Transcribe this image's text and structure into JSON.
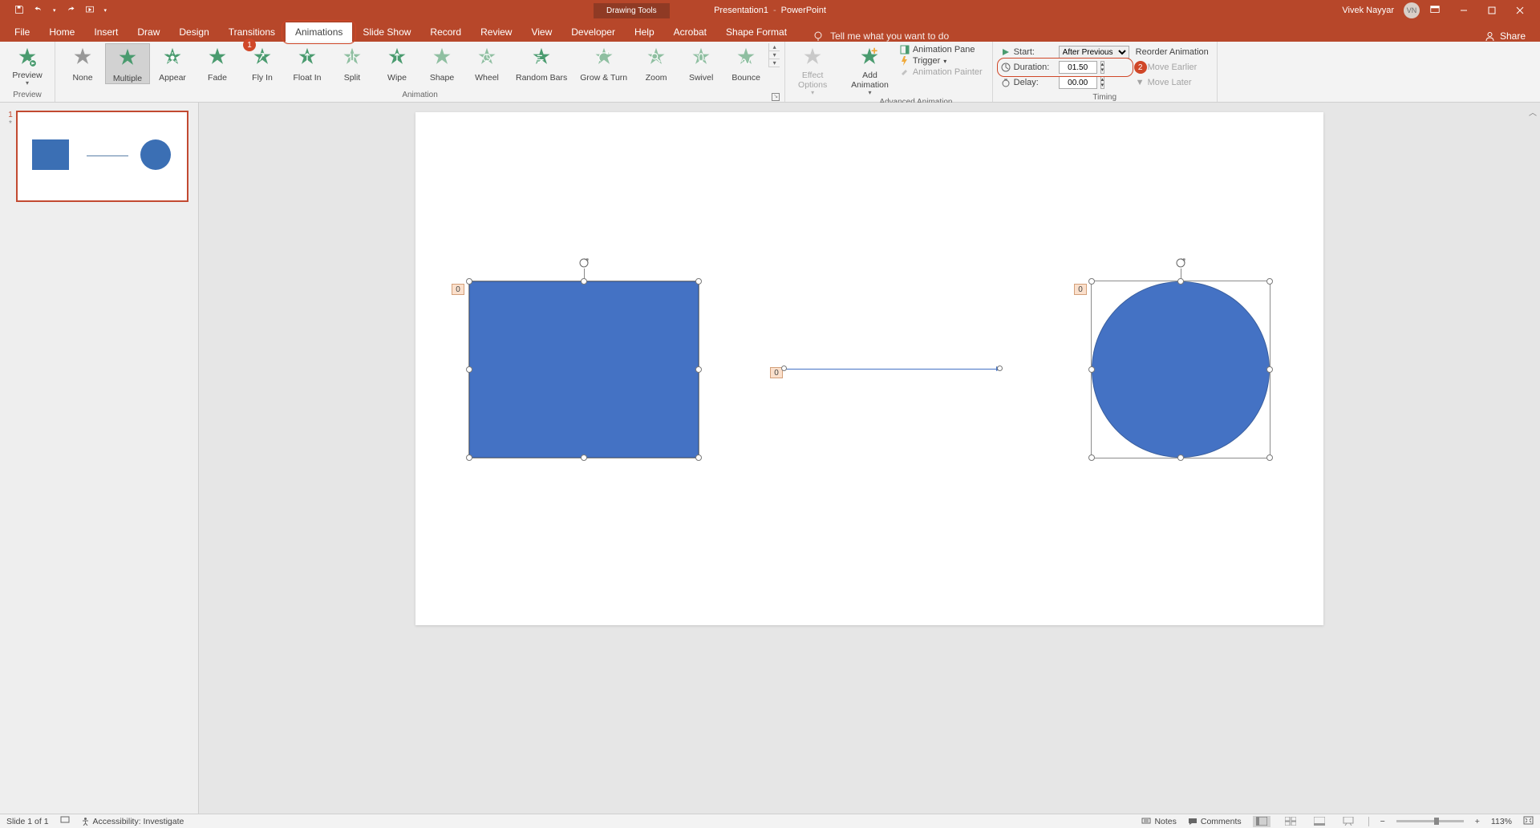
{
  "title": {
    "doc": "Presentation1",
    "app": "PowerPoint",
    "tool_context": "Drawing Tools"
  },
  "user": {
    "name": "Vivek Nayyar",
    "initials": "VN"
  },
  "share_label": "Share",
  "tabs": {
    "file": "File",
    "home": "Home",
    "insert": "Insert",
    "draw": "Draw",
    "design": "Design",
    "transitions": "Transitions",
    "animations": "Animations",
    "slideshow": "Slide Show",
    "record": "Record",
    "review": "Review",
    "view": "View",
    "developer": "Developer",
    "help": "Help",
    "acrobat": "Acrobat",
    "shapeformat": "Shape Format"
  },
  "tellme": "Tell me what you want to do",
  "ribbon": {
    "preview": {
      "label": "Preview",
      "group": "Preview"
    },
    "animations": {
      "group": "Animation",
      "items": [
        "None",
        "Multiple",
        "Appear",
        "Fade",
        "Fly In",
        "Float In",
        "Split",
        "Wipe",
        "Shape",
        "Wheel",
        "Random Bars",
        "Grow & Turn",
        "Zoom",
        "Swivel",
        "Bounce"
      ],
      "selected": "Multiple",
      "badge_on": "Fly In",
      "badge_val": "1"
    },
    "effect_options": "Effect\nOptions",
    "add_animation": "Add\nAnimation",
    "advanced": {
      "group": "Advanced Animation",
      "pane": "Animation Pane",
      "trigger": "Trigger",
      "painter": "Animation Painter"
    },
    "timing": {
      "group": "Timing",
      "start_label": "Start:",
      "start_value": "After Previous",
      "duration_label": "Duration:",
      "duration_value": "01.50",
      "delay_label": "Delay:",
      "delay_value": "00.00"
    },
    "reorder": {
      "title": "Reorder Animation",
      "earlier": "Move Earlier",
      "later": "Move Later"
    },
    "callouts": {
      "badge1": "1",
      "badge2": "2"
    }
  },
  "slide": {
    "number": "1",
    "star": "*",
    "anim_tag_rect": "0",
    "anim_tag_line": "0",
    "anim_tag_circ": "0"
  },
  "status": {
    "slide": "Slide 1 of 1",
    "access": "Accessibility: Investigate",
    "notes": "Notes",
    "comments": "Comments",
    "zoom": "113%"
  }
}
